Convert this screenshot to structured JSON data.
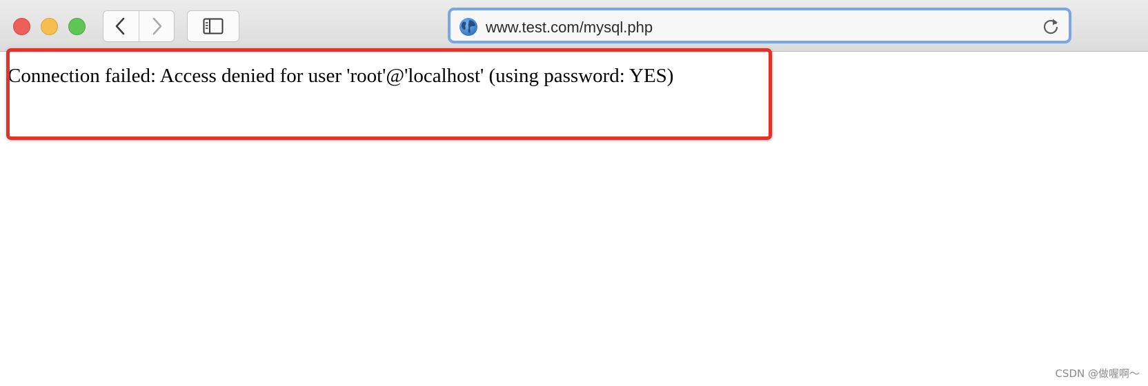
{
  "browser": {
    "window_controls": {
      "close_color": "#ee5f5a",
      "minimize_color": "#f6be4f",
      "maximize_color": "#5fc655"
    },
    "nav": {
      "back_icon": "chevron-left-icon",
      "forward_icon": "chevron-right-icon",
      "sidebar_icon": "sidebar-icon"
    },
    "address_bar": {
      "url": "www.test.com/mysql.php",
      "site_icon": "globe-icon",
      "reload_icon": "reload-icon",
      "focus_color": "#7aa6e8"
    }
  },
  "page": {
    "message": "Connection failed: Access denied for user 'root'@'localhost' (using password: YES)",
    "highlight_color": "#e0342a"
  },
  "watermark": "CSDN @做喔啊～"
}
